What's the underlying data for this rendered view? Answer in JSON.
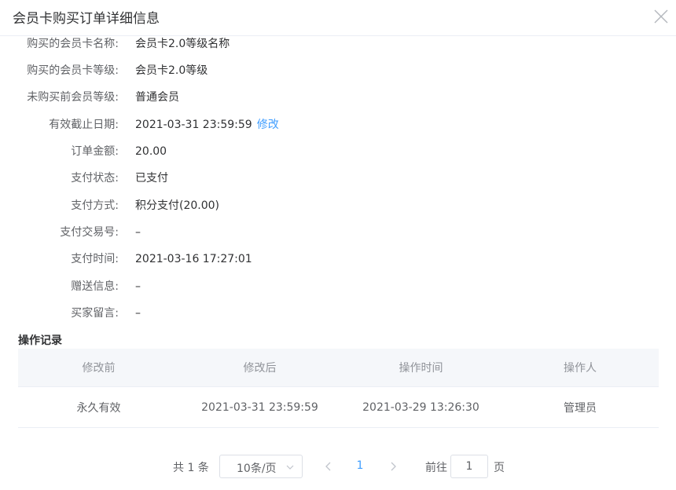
{
  "dialog": {
    "title": "会员卡购买订单详细信息"
  },
  "details": [
    {
      "label": "购买的会员卡名称:",
      "value": "会员卡2.0等级名称"
    },
    {
      "label": "购买的会员卡等级:",
      "value": "会员卡2.0等级"
    },
    {
      "label": "未购买前会员等级:",
      "value": "普通会员"
    },
    {
      "label": "有效截止日期:",
      "value": "2021-03-31 23:59:59",
      "action": "修改"
    },
    {
      "label": "订单金额:",
      "value": "20.00"
    },
    {
      "label": "支付状态:",
      "value": "已支付"
    },
    {
      "label": "支付方式:",
      "value": "积分支付(20.00)"
    },
    {
      "label": "支付交易号:",
      "value": "–"
    },
    {
      "label": "支付时间:",
      "value": "2021-03-16 17:27:01"
    },
    {
      "label": "赠送信息:",
      "value": "–"
    },
    {
      "label": "买家留言:",
      "value": "–"
    }
  ],
  "log": {
    "title": "操作记录",
    "headers": [
      "修改前",
      "修改后",
      "操作时间",
      "操作人"
    ],
    "rows": [
      [
        "永久有效",
        "2021-03-31 23:59:59",
        "2021-03-29 13:26:30",
        "管理员"
      ]
    ]
  },
  "pagination": {
    "total": "共 1 条",
    "page_size": "10条/页",
    "current_page": "1",
    "goto_label": "前往",
    "goto_value": "1",
    "page_suffix": "页"
  },
  "icons": {
    "close": "close-icon",
    "dropdown": "chevron-down-icon",
    "prev": "chevron-left-icon",
    "next": "chevron-right-icon"
  },
  "colors": {
    "link": "#409eff",
    "header_bg": "#f5f7fa",
    "border": "#ebeef5"
  }
}
